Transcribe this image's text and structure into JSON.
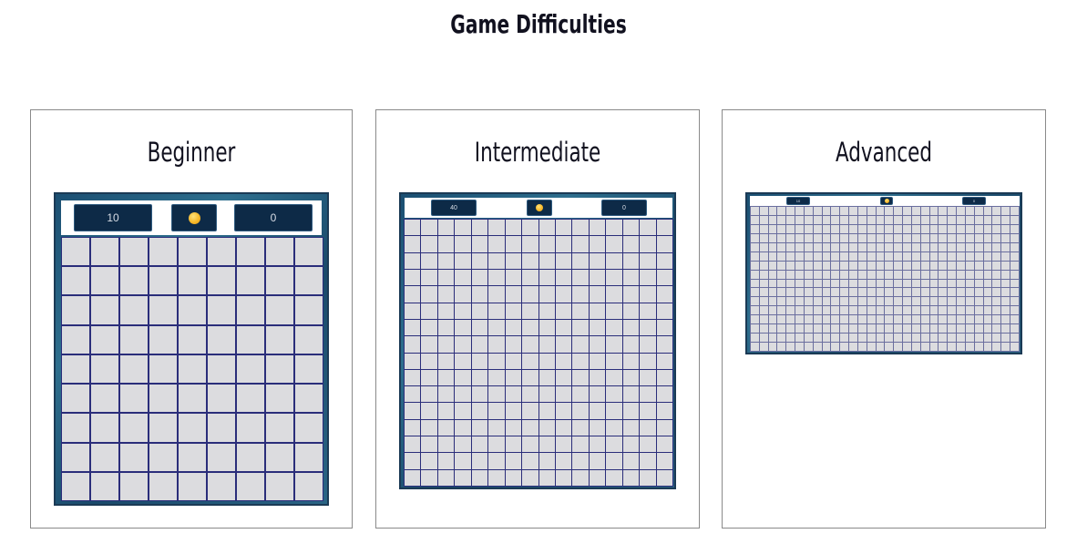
{
  "page": {
    "title": "Game Difficulties"
  },
  "difficulties": [
    {
      "name": "Beginner",
      "mines": "10",
      "timer": "0",
      "face_icon": "smiley-face-icon",
      "rows": 9,
      "cols": 9
    },
    {
      "name": "Intermediate",
      "mines": "40",
      "timer": "0",
      "face_icon": "smiley-face-icon",
      "rows": 16,
      "cols": 16
    },
    {
      "name": "Advanced",
      "mines": "10",
      "timer": "0",
      "face_icon": "smiley-face-icon",
      "rows": 16,
      "cols": 30
    }
  ],
  "colors": {
    "board_frame": "#1b4f72",
    "counter_bg": "#0d2a47",
    "cell_bg": "#dcdcdf",
    "grid_line": "#2a2d7a"
  }
}
